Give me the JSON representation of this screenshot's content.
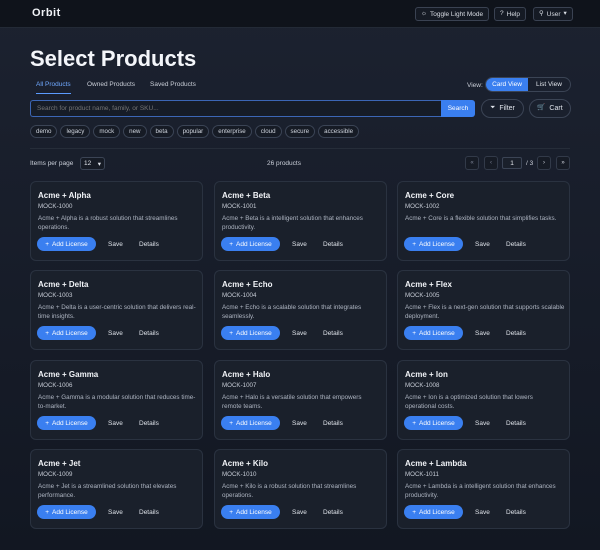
{
  "app": {
    "brand": "Orbit"
  },
  "topbar": {
    "toggle_label": "Toggle Light Mode",
    "help_label": "Help",
    "user_label": "User"
  },
  "page": {
    "title": "Select Products"
  },
  "tabs": [
    {
      "label": "All Products",
      "active": true
    },
    {
      "label": "Owned Products",
      "active": false
    },
    {
      "label": "Saved Products",
      "active": false
    }
  ],
  "view": {
    "label": "View:",
    "card_label": "Card View",
    "list_label": "List View",
    "selected": "Card View"
  },
  "search": {
    "placeholder": "Search for product name, family, or SKU...",
    "value": "",
    "button_label": "Search"
  },
  "filter_label": "Filter",
  "cart_label": "Cart",
  "tags": [
    "demo",
    "legacy",
    "mock",
    "new",
    "beta",
    "popular",
    "enterprise",
    "cloud",
    "secure",
    "accessible"
  ],
  "pagination": {
    "items_per_page_label": "Items per page",
    "items_per_page": "12",
    "total_label": "26 products",
    "current_page": "1",
    "total_pages_label": "/ 3"
  },
  "card_actions": {
    "add_label": "Add License",
    "save_label": "Save",
    "details_label": "Details"
  },
  "products": [
    {
      "name": "Acme + Alpha",
      "sku": "MOCK-1000",
      "desc": "Acme + Alpha is a robust solution that streamlines operations."
    },
    {
      "name": "Acme + Beta",
      "sku": "MOCK-1001",
      "desc": "Acme + Beta is a intelligent solution that enhances productivity."
    },
    {
      "name": "Acme + Core",
      "sku": "MOCK-1002",
      "desc": "Acme + Core is a flexible solution that simplifies tasks."
    },
    {
      "name": "Acme + Delta",
      "sku": "MOCK-1003",
      "desc": "Acme + Delta is a user-centric solution that delivers real-time insights."
    },
    {
      "name": "Acme + Echo",
      "sku": "MOCK-1004",
      "desc": "Acme + Echo is a scalable solution that integrates seamlessly."
    },
    {
      "name": "Acme + Flex",
      "sku": "MOCK-1005",
      "desc": "Acme + Flex is a next-gen solution that supports scalable deployment."
    },
    {
      "name": "Acme + Gamma",
      "sku": "MOCK-1006",
      "desc": "Acme + Gamma is a modular solution that reduces time-to-market."
    },
    {
      "name": "Acme + Halo",
      "sku": "MOCK-1007",
      "desc": "Acme + Halo is a versatile solution that empowers remote teams."
    },
    {
      "name": "Acme + Ion",
      "sku": "MOCK-1008",
      "desc": "Acme + Ion is a optimized solution that lowers operational costs."
    },
    {
      "name": "Acme + Jet",
      "sku": "MOCK-1009",
      "desc": "Acme + Jet is a streamlined solution that elevates performance."
    },
    {
      "name": "Acme + Kilo",
      "sku": "MOCK-1010",
      "desc": "Acme + Kilo is a robust solution that streamlines operations."
    },
    {
      "name": "Acme + Lambda",
      "sku": "MOCK-1011",
      "desc": "Acme + Lambda is a intelligent solution that enhances productivity."
    }
  ],
  "colors": {
    "accent": "#3a7ff0",
    "background": "#151a24",
    "card": "#1a202b"
  }
}
